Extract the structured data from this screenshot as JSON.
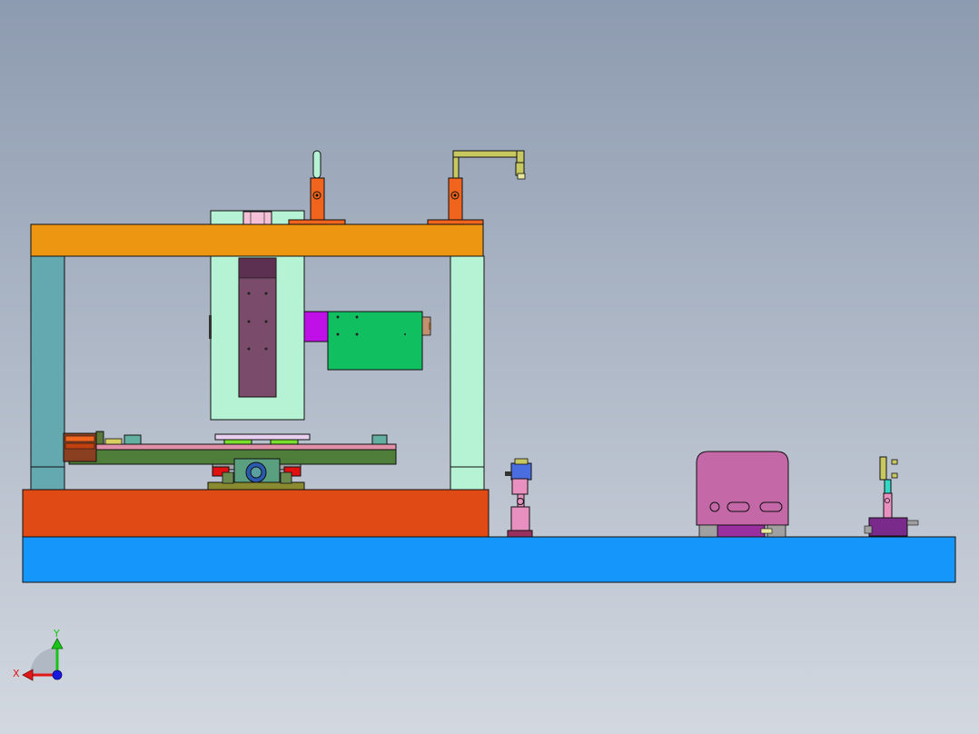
{
  "viewport": {
    "background_top": "#8d9bb0",
    "background_bottom": "#d3d8e0"
  },
  "colors": {
    "frame_top": "#ed9612",
    "frame_post_left": "#64a8b0",
    "frame_post_right": "#b6f2d4",
    "base_block": "#e04a14",
    "base_plate": "#1496fa",
    "press_frame": "#b6f2d4",
    "ram_plate": "#7a4b6a",
    "motor_box": "#10c060",
    "motor_adapter": "#c010e8",
    "cylinder": "#f0641e",
    "rod": "#b6f2d4",
    "arm": "#c8c860",
    "bed_plate": "#4f7d3a",
    "rail": "#e090a8",
    "hood": "#c468a8",
    "valve_body": "#e890c0",
    "solenoid": "#4a6ee0",
    "small_stage": "#7a2a8a",
    "clamp_red": "#e01010",
    "grey_part": "#a0a0a0"
  },
  "triad": {
    "x_label": "X",
    "y_label": "Y",
    "x_color": "#e01818",
    "y_color": "#18c418",
    "z_color": "#1818e0"
  }
}
